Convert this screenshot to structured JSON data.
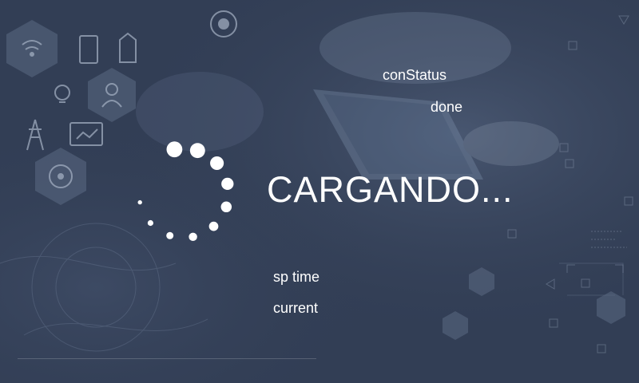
{
  "background": {
    "base_color": "#323e55",
    "hex_icons": [
      "wifi-icon",
      "atom-icon",
      "worker-icon",
      "lightbulb-icon",
      "power-tower-icon",
      "monitor-chart-icon",
      "radiation-icon"
    ]
  },
  "status": {
    "label": "conStatus",
    "value": "done"
  },
  "loading": {
    "text": "CARGANDO..."
  },
  "sp_time": {
    "label": "sp time"
  },
  "current": {
    "label": "current"
  },
  "spinner": {
    "color": "#ffffff",
    "dot_count": 10
  }
}
